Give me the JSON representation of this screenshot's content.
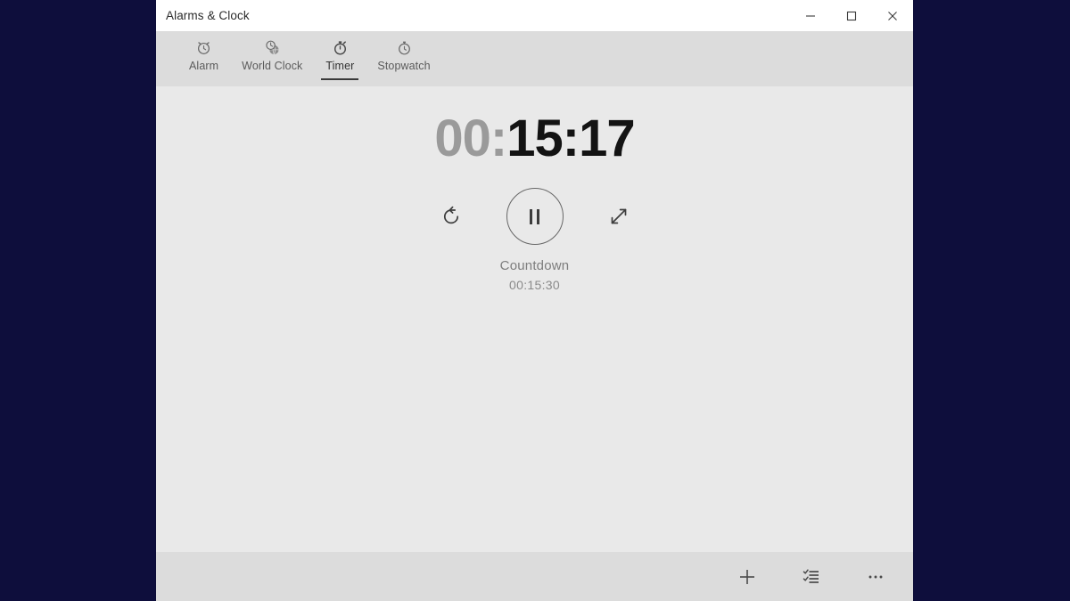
{
  "window": {
    "title": "Alarms & Clock",
    "controls": {
      "minimize": "minimize-icon",
      "maximize": "maximize-icon",
      "close": "close-icon"
    }
  },
  "tabs": [
    {
      "label": "Alarm",
      "icon": "alarm-clock-icon",
      "active": false
    },
    {
      "label": "World Clock",
      "icon": "world-clock-icon",
      "active": false
    },
    {
      "label": "Timer",
      "icon": "timer-icon",
      "active": true
    },
    {
      "label": "Stopwatch",
      "icon": "stopwatch-icon",
      "active": false
    }
  ],
  "timer": {
    "remaining": {
      "hours": "00",
      "separator_1": ":",
      "minutes": "15",
      "separator_2": ":",
      "seconds": "17",
      "full": "00:15:17"
    },
    "name": "Countdown",
    "total_duration": "00:15:30",
    "state": "running",
    "controls": {
      "reset_icon": "reset-icon",
      "pause_icon": "pause-icon",
      "expand_icon": "expand-icon"
    }
  },
  "command_bar": {
    "add_label": "add-icon",
    "list_label": "list-view-icon",
    "more_label": "more-options-icon"
  },
  "colors": {
    "backdrop": "#0e0e3c",
    "title_bar": "#ffffff",
    "tab_bar": "#dcdcdc",
    "content": "#e9e9e9",
    "command_bar": "#dcdcdc",
    "timer_elapsed": "#9a9a9a",
    "timer_active": "#131313",
    "accent_underline": "#3a3a3a"
  }
}
